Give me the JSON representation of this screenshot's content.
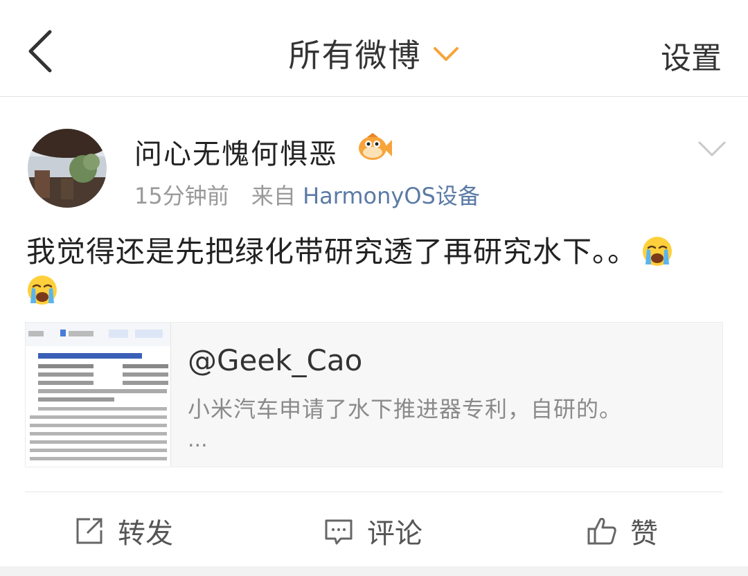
{
  "header": {
    "title": "所有微博",
    "settings_label": "设置"
  },
  "post": {
    "username": "问心无愧何惧恶",
    "time": "15分钟前",
    "source_prefix": "来自",
    "source": "HarmonyOS设备",
    "content": "我觉得还是先把绿化带研究透了再研究水下。。",
    "repost_card": {
      "author": "@Geek_Cao",
      "text": "小米汽车申请了水下推进器专利，自研的。",
      "ellipsis": "..."
    },
    "actions": {
      "repost": "转发",
      "comment": "评论",
      "like": "赞"
    }
  },
  "colors": {
    "accent_orange": "#f7a43a",
    "link_blue": "#5b7aa5"
  }
}
